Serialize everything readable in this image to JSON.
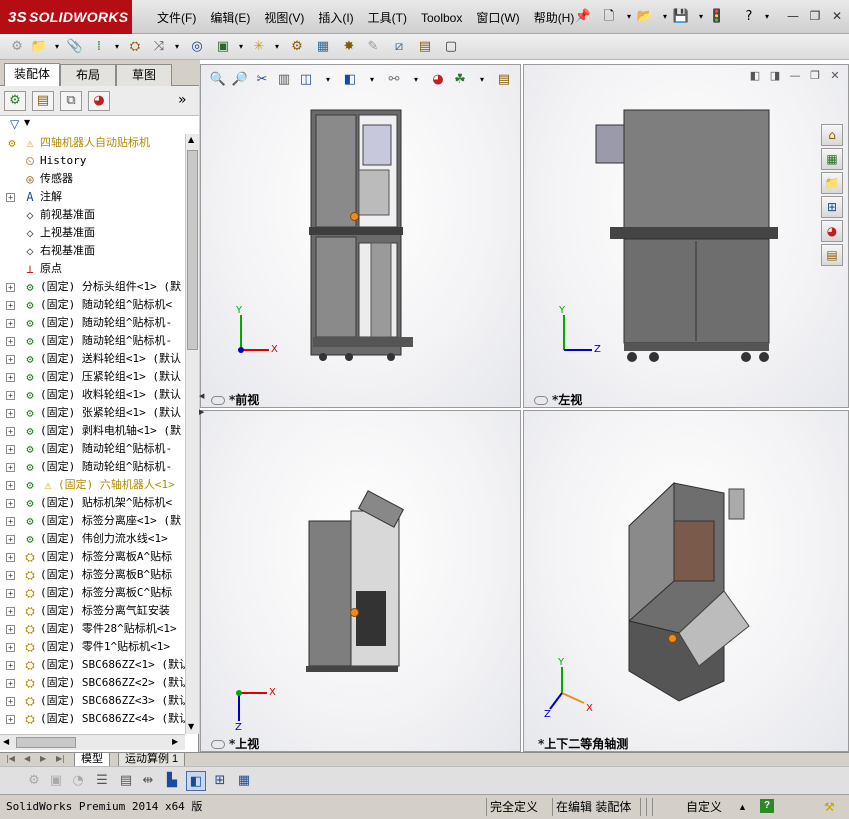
{
  "app": {
    "logo_prefix": "3S",
    "logo_text": "SOLIDWORKS"
  },
  "menu": [
    "文件(F)",
    "编辑(E)",
    "视图(V)",
    "插入(I)",
    "工具(T)",
    "Toolbox",
    "窗口(W)",
    "帮助(H)"
  ],
  "featuremanager": {
    "tabs": [
      "装配体",
      "布局",
      "草图"
    ],
    "expand_glyph": "»",
    "filter_glyph": "▼",
    "tree": [
      {
        "label": "四轴机器人自动贴标机",
        "icon": "assembly-warning-icon",
        "warn": true,
        "expand": false,
        "indent": 0
      },
      {
        "label": "History",
        "icon": "history-icon",
        "expand": false,
        "indent": 1
      },
      {
        "label": "传感器",
        "icon": "sensor-icon",
        "expand": false,
        "indent": 1
      },
      {
        "label": "注解",
        "icon": "annotation-icon",
        "expand": true,
        "indent": 1
      },
      {
        "label": "前视基准面",
        "icon": "plane-icon",
        "expand": false,
        "indent": 1
      },
      {
        "label": "上视基准面",
        "icon": "plane-icon",
        "expand": false,
        "indent": 1
      },
      {
        "label": "右视基准面",
        "icon": "plane-icon",
        "expand": false,
        "indent": 1
      },
      {
        "label": "原点",
        "icon": "origin-icon",
        "expand": false,
        "indent": 1
      },
      {
        "label": "(固定) 分标头组件<1> (默",
        "icon": "subassembly-icon",
        "expand": true,
        "indent": 1
      },
      {
        "label": "(固定) 随动轮组^贴标机<",
        "icon": "subassembly-icon",
        "expand": true,
        "indent": 1
      },
      {
        "label": "(固定) 随动轮组^贴标机-",
        "icon": "subassembly-icon",
        "expand": true,
        "indent": 1
      },
      {
        "label": "(固定) 随动轮组^贴标机-",
        "icon": "subassembly-icon",
        "expand": true,
        "indent": 1
      },
      {
        "label": "(固定) 送料轮组<1> (默认",
        "icon": "subassembly-icon",
        "expand": true,
        "indent": 1
      },
      {
        "label": "(固定) 压紧轮组<1> (默认",
        "icon": "subassembly-icon",
        "expand": true,
        "indent": 1
      },
      {
        "label": "(固定) 收料轮组<1> (默认",
        "icon": "subassembly-icon",
        "expand": true,
        "indent": 1
      },
      {
        "label": "(固定) 张紧轮组<1> (默认",
        "icon": "subassembly-icon",
        "expand": true,
        "indent": 1
      },
      {
        "label": "(固定) 剥料电机轴<1> (默",
        "icon": "subassembly-icon",
        "expand": true,
        "indent": 1
      },
      {
        "label": "(固定) 随动轮组^贴标机-",
        "icon": "subassembly-icon",
        "expand": true,
        "indent": 1
      },
      {
        "label": "(固定) 随动轮组^贴标机-",
        "icon": "subassembly-icon",
        "expand": true,
        "indent": 1
      },
      {
        "label": "(固定) 六轴机器人<1>",
        "icon": "subassembly-warning-icon",
        "warn": true,
        "expand": true,
        "indent": 1
      },
      {
        "label": "(固定) 贴标机架^贴标机<",
        "icon": "subassembly-icon",
        "expand": true,
        "indent": 1
      },
      {
        "label": "(固定) 标签分离座<1> (默",
        "icon": "subassembly-icon",
        "expand": true,
        "indent": 1
      },
      {
        "label": "(固定) 伟创力流水线<1>",
        "icon": "subassembly-icon",
        "expand": true,
        "indent": 1
      },
      {
        "label": "(固定) 标签分离板A^贴标",
        "icon": "part-icon",
        "expand": true,
        "indent": 1
      },
      {
        "label": "(固定) 标签分离板B^贴标",
        "icon": "part-icon",
        "expand": true,
        "indent": 1
      },
      {
        "label": "(固定) 标签分离板C^贴标",
        "icon": "part-icon",
        "expand": true,
        "indent": 1
      },
      {
        "label": "(固定) 标签分离气缸安装",
        "icon": "part-icon",
        "expand": true,
        "indent": 1
      },
      {
        "label": "(固定) 零件28^贴标机<1>",
        "icon": "part-icon",
        "expand": true,
        "indent": 1
      },
      {
        "label": "(固定) 零件1^贴标机<1>",
        "icon": "part-icon",
        "expand": true,
        "indent": 1
      },
      {
        "label": "(固定) SBC686ZZ<1> (默认",
        "icon": "part-icon",
        "expand": true,
        "indent": 1
      },
      {
        "label": "(固定) SBC686ZZ<2> (默认",
        "icon": "part-icon",
        "expand": true,
        "indent": 1
      },
      {
        "label": "(固定) SBC686ZZ<3> (默认",
        "icon": "part-icon",
        "expand": true,
        "indent": 1
      },
      {
        "label": "(固定) SBC686ZZ<4> (默认",
        "icon": "part-icon",
        "expand": true,
        "indent": 1
      }
    ]
  },
  "viewports": [
    {
      "label": "*前视",
      "axes": [
        "Y",
        "X"
      ]
    },
    {
      "label": "*左视",
      "axes": [
        "Y",
        "Z"
      ]
    },
    {
      "label": "*上视",
      "axes": [
        "X",
        "Z"
      ]
    },
    {
      "label": "*上下二等角轴测",
      "axes": [
        "Y",
        "Z",
        "X"
      ]
    }
  ],
  "bottom_tabs": [
    "模型",
    "运动算例 1"
  ],
  "status": {
    "product": "SolidWorks Premium 2014 x64 版",
    "definition": "完全定义",
    "editing": "在编辑 装配体",
    "custom": "自定义",
    "help_glyph": "?"
  },
  "colors": {
    "brand_red": "#b40d14",
    "frame_dark": "#4a4a4a",
    "panel_gray": "#8e8e8e",
    "accent_orange": "#f08a1c"
  }
}
